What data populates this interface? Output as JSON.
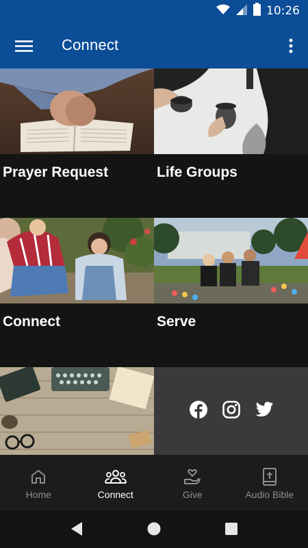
{
  "status_bar": {
    "time": "10:26"
  },
  "app_bar": {
    "title": "Connect"
  },
  "tiles": [
    {
      "label": "Prayer Request"
    },
    {
      "label": "Life Groups"
    },
    {
      "label": "Connect"
    },
    {
      "label": "Serve"
    }
  ],
  "social": {
    "icons": [
      "facebook-icon",
      "instagram-icon",
      "twitter-icon"
    ]
  },
  "bottom_nav": {
    "items": [
      {
        "label": "Home",
        "icon": "home-icon",
        "active": false
      },
      {
        "label": "Connect",
        "icon": "people-icon",
        "active": true
      },
      {
        "label": "Give",
        "icon": "give-icon",
        "active": false
      },
      {
        "label": "Audio Bible",
        "icon": "bible-icon",
        "active": false
      }
    ]
  },
  "colors": {
    "app_bar": "#0b4d97",
    "background": "#151515",
    "social_tile": "#3a3a3a"
  }
}
